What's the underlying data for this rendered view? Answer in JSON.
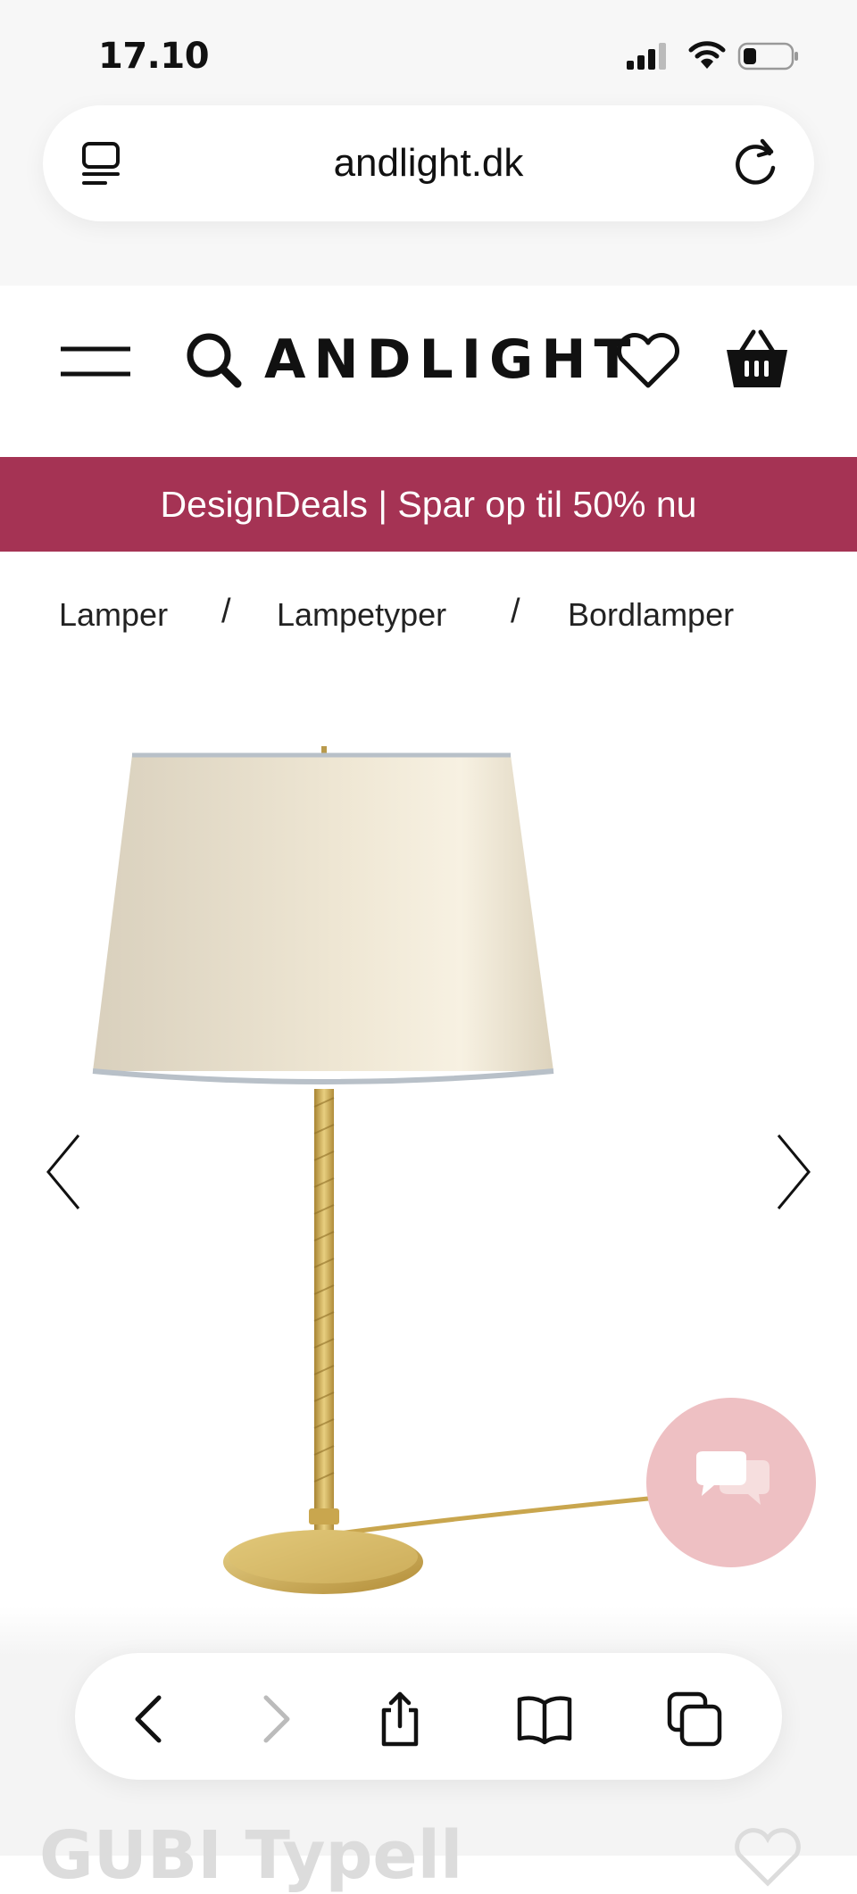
{
  "status_bar": {
    "time": "17.10"
  },
  "browser": {
    "url": "andlight.dk"
  },
  "site_header": {
    "logo": "ANDLIGHT"
  },
  "promo": {
    "text": "DesignDeals | Spar op til 50% nu"
  },
  "breadcrumb": {
    "items": [
      "Lamper",
      "Lampetyper",
      "Bordlamper"
    ],
    "separator": "/"
  },
  "product": {
    "title_peek": "GUBI Typell"
  },
  "colors": {
    "promo_bg": "#a53354",
    "chat_bg": "#eec0c3",
    "brass": "#c9a64e"
  },
  "icons": {
    "status": [
      "signal-icon",
      "wifi-icon",
      "battery-icon"
    ],
    "browser": [
      "tabs-icon",
      "reload-icon"
    ],
    "header": [
      "menu-icon",
      "search-icon",
      "heart-icon",
      "basket-icon"
    ],
    "toolbar": [
      "back-icon",
      "forward-icon",
      "share-icon",
      "bookmarks-icon",
      "tabs-overview-icon"
    ]
  }
}
